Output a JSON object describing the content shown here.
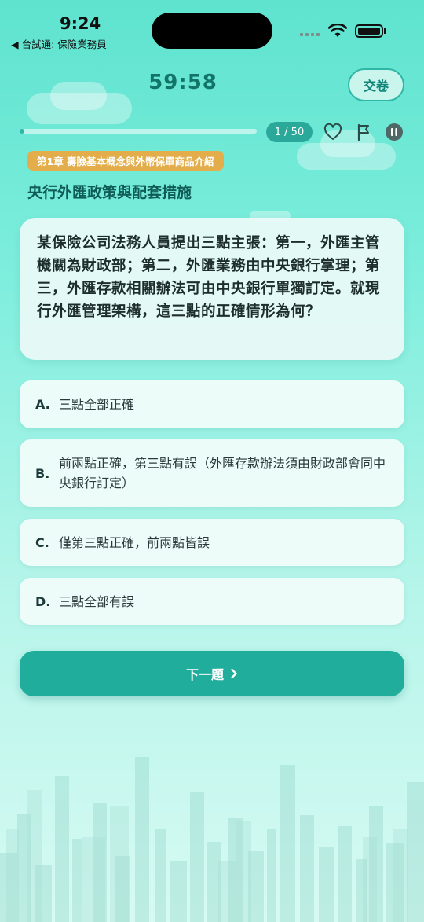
{
  "status_bar": {
    "time": "9:24",
    "back_app": "◀ 台試通: 保險業務員"
  },
  "header": {
    "timer": "59:58",
    "submit_label": "交卷"
  },
  "progress": {
    "current": 1,
    "total": 50,
    "counter_text": "1 / 50",
    "fraction": 0.02
  },
  "chapter_tag": "第1章 壽險基本概念與外幣保單商品介紹",
  "topic": "央行外匯政策與配套措施",
  "question": "某保險公司法務人員提出三點主張：第一，外匯主管機關為財政部；第二，外匯業務由中央銀行掌理；第三，外匯存款相關辦法可由中央銀行單獨訂定。就現行外匯管理架構，這三點的正確情形為何？",
  "options": [
    {
      "letter": "A.",
      "text": "三點全部正確"
    },
    {
      "letter": "B.",
      "text": "前兩點正確，第三點有誤（外匯存款辦法須由財政部會同中央銀行訂定）"
    },
    {
      "letter": "C.",
      "text": "僅第三點正確，前兩點皆誤"
    },
    {
      "letter": "D.",
      "text": "三點全部有誤"
    }
  ],
  "next_label": "下一題",
  "icons": {
    "favorite": "heart-icon",
    "flag": "flag-icon",
    "pause": "pause-icon",
    "next": "chevron-right-icon"
  },
  "colors": {
    "accent": "#21ad9b",
    "tag": "#e2ad4a",
    "title": "#0f5c55"
  }
}
